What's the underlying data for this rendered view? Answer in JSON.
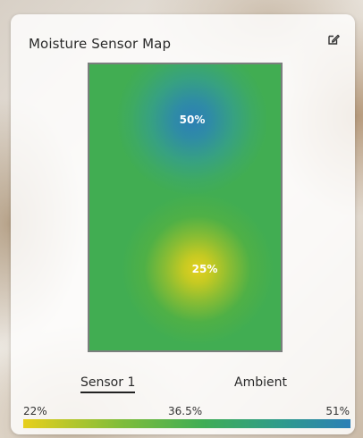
{
  "card": {
    "title": "Moisture Sensor Map",
    "edit_icon": "edit-icon"
  },
  "map": {
    "zones": [
      {
        "label": "50%",
        "value": 50,
        "color": "#2c7fb6"
      },
      {
        "label": "25%",
        "value": 25,
        "color": "#e3d020"
      }
    ],
    "base_color": "#41ad52"
  },
  "tabs": [
    {
      "label": "Sensor 1",
      "active": true
    },
    {
      "label": "Ambient",
      "active": false
    }
  ],
  "scale": {
    "min_label": "22%",
    "mid_label": "36.5%",
    "max_label": "51%",
    "colors": [
      "#e7cf1c",
      "#3fad55",
      "#2c7fb6"
    ]
  }
}
